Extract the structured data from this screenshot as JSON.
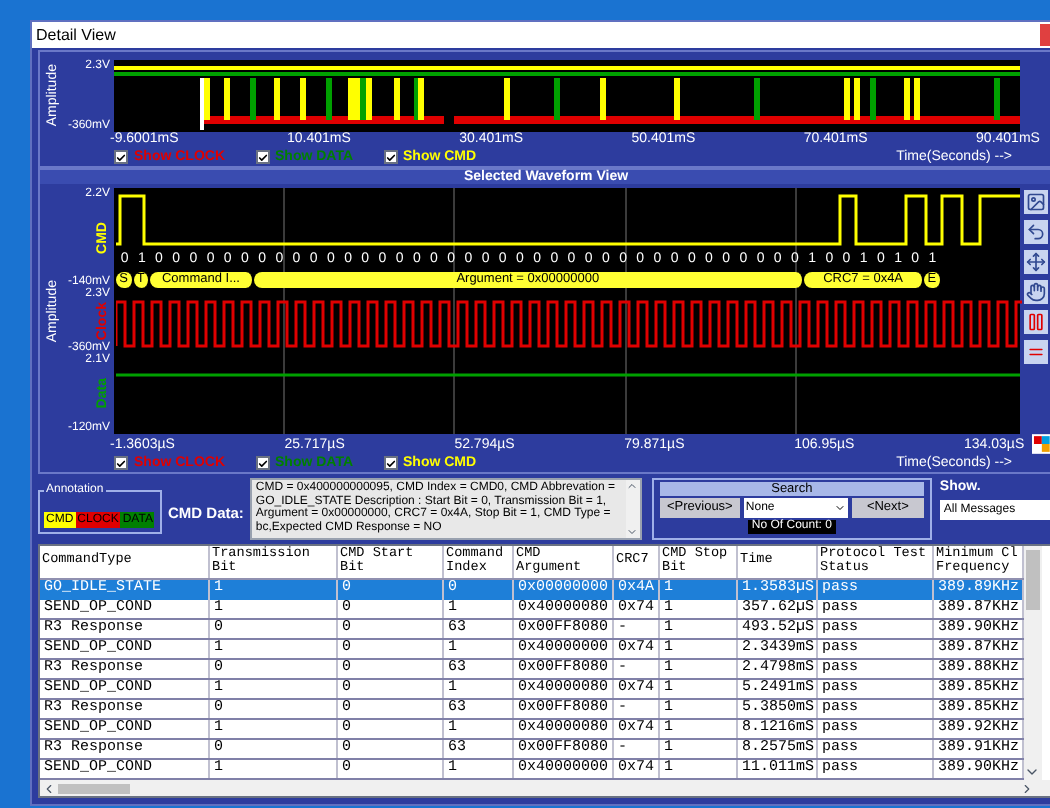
{
  "window": {
    "title": "Detail View"
  },
  "overview": {
    "amplitude_label": "Amplitude",
    "y_top": "2.3V",
    "y_bottom": "-360mV",
    "x_ticks": [
      "-9.6001mS",
      "10.401mS",
      "30.401mS",
      "50.401mS",
      "70.401mS",
      "90.401mS"
    ],
    "x_axis_label": "Time(Seconds) -->",
    "toggles": [
      {
        "label": "Show CLOCK",
        "checked": true,
        "color": "#e00000"
      },
      {
        "label": "Show DATA",
        "checked": true,
        "color": "#008000"
      },
      {
        "label": "Show CMD",
        "checked": true,
        "color": "#ffff00"
      }
    ]
  },
  "waveform_view": {
    "title": "Selected Waveform View",
    "amplitude_label": "Amplitude",
    "channels": [
      {
        "kind": "cmd",
        "name": "CMD",
        "color": "#ffff00",
        "y_top": "2.2V",
        "y_bottom": "-140mV"
      },
      {
        "kind": "clock",
        "name": "Clock",
        "color": "#e00000",
        "y_top": "2.3V",
        "y_bottom": "-360mV"
      },
      {
        "kind": "data",
        "name": "Data",
        "color": "#00a000",
        "y_top": "2.1V",
        "y_bottom": "-120mV"
      }
    ],
    "bits": [
      "0",
      "1",
      "0",
      "0",
      "0",
      "0",
      "0",
      "0",
      "0",
      "0",
      "0",
      "0",
      "0",
      "0",
      "0",
      "0",
      "0",
      "0",
      "0",
      "0",
      "0",
      "0",
      "0",
      "0",
      "0",
      "0",
      "0",
      "0",
      "0",
      "0",
      "0",
      "0",
      "0",
      "0",
      "0",
      "0",
      "0",
      "0",
      "0",
      "0",
      "1",
      "0",
      "0",
      "1",
      "0",
      "1",
      "0",
      "1"
    ],
    "segments": [
      "S",
      "T",
      "Command I...",
      "Argument = 0x00000000",
      "CRC7 = 0x4A",
      "E"
    ],
    "x_ticks": [
      "-1.3603µS",
      "25.717µS",
      "52.794µS",
      "79.871µS",
      "106.95µS",
      "134.03µS"
    ],
    "x_axis_label": "Time(Seconds) -->",
    "toggles": [
      {
        "label": "Show CLOCK",
        "checked": true,
        "color": "#e00000"
      },
      {
        "label": "Show DATA",
        "checked": true,
        "color": "#008000"
      },
      {
        "label": "Show CMD",
        "checked": true,
        "color": "#ffff00"
      }
    ]
  },
  "annotation": {
    "title": "Annotation",
    "legend": [
      {
        "label": "CMD",
        "color": "#ffff00"
      },
      {
        "label": "CLOCK",
        "color": "#e00000"
      },
      {
        "label": "DATA",
        "color": "#008000"
      }
    ]
  },
  "cmd_data": {
    "label": "CMD Data:",
    "text": "CMD = 0x400000000095, CMD Index = CMD0, CMD Abbrevation = GO_IDLE_STATE Description : Start Bit = 0, Transmission Bit = 1, Argument = 0x00000000, CRC7 = 0x4A, Stop Bit = 1, CMD Type = bc,Expected CMD Response = NO"
  },
  "search": {
    "title": "Search",
    "previous": "<Previous>",
    "mode": "None",
    "next": "<Next>",
    "count": "No Of Count: 0"
  },
  "show": {
    "label": "Show.",
    "value": "All Messages"
  },
  "table": {
    "columns": [
      "CommandType",
      "Transmission Bit",
      "CMD Start Bit",
      "Command Index",
      "CMD Argument",
      "CRC7",
      "CMD Stop Bit",
      "Time",
      "Protocol Test Status",
      "Minimum Cl Frequency"
    ],
    "rows": [
      {
        "selected": true,
        "cells": [
          "GO_IDLE_STATE",
          "1",
          "0",
          "0",
          "0x00000000",
          "0x4A",
          "1",
          "1.3583µS",
          "pass",
          "389.89KHz"
        ]
      },
      {
        "selected": false,
        "cells": [
          "SEND_OP_COND",
          "1",
          "0",
          "1",
          "0x40000080",
          "0x74",
          "1",
          "357.62µS",
          "pass",
          "389.87KHz"
        ]
      },
      {
        "selected": false,
        "cells": [
          "R3 Response",
          "0",
          "0",
          "63",
          "0x00FF8080",
          "-",
          "1",
          "493.52µS",
          "pass",
          "389.90KHz"
        ]
      },
      {
        "selected": false,
        "cells": [
          "SEND_OP_COND",
          "1",
          "0",
          "1",
          "0x40000000",
          "0x74",
          "1",
          "2.3439mS",
          "pass",
          "389.87KHz"
        ]
      },
      {
        "selected": false,
        "cells": [
          "R3 Response",
          "0",
          "0",
          "63",
          "0x00FF8080",
          "-",
          "1",
          "2.4798mS",
          "pass",
          "389.88KHz"
        ]
      },
      {
        "selected": false,
        "cells": [
          "SEND_OP_COND",
          "1",
          "0",
          "1",
          "0x40000080",
          "0x74",
          "1",
          "5.2491mS",
          "pass",
          "389.85KHz"
        ]
      },
      {
        "selected": false,
        "cells": [
          "R3 Response",
          "0",
          "0",
          "63",
          "0x00FF8080",
          "-",
          "1",
          "5.3850mS",
          "pass",
          "389.85KHz"
        ]
      },
      {
        "selected": false,
        "cells": [
          "SEND_OP_COND",
          "1",
          "0",
          "1",
          "0x40000080",
          "0x74",
          "1",
          "8.1216mS",
          "pass",
          "389.92KHz"
        ]
      },
      {
        "selected": false,
        "cells": [
          "R3 Response",
          "0",
          "0",
          "63",
          "0x00FF8080",
          "-",
          "1",
          "8.2575mS",
          "pass",
          "389.91KHz"
        ]
      },
      {
        "selected": false,
        "cells": [
          "SEND_OP_COND",
          "1",
          "0",
          "1",
          "0x40000000",
          "0x74",
          "1",
          "11.011mS",
          "pass",
          "389.90KHz"
        ]
      }
    ]
  }
}
